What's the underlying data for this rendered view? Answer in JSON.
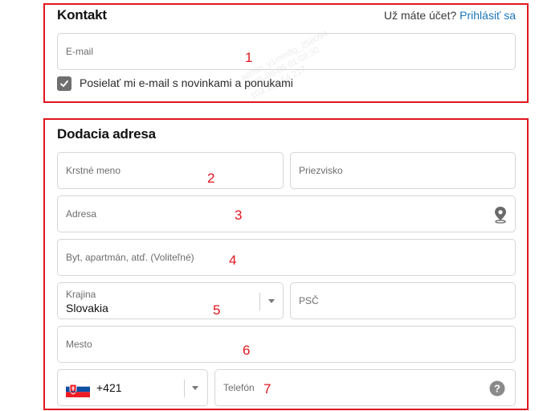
{
  "contact": {
    "title": "Kontakt",
    "login_prompt": "Už máte účet?",
    "login_link": "Prihlásiť sa",
    "email_placeholder": "E-mail",
    "newsletter_label": "Posielať mi e-mail s novinkami a ponukami",
    "newsletter_checked": true
  },
  "shipping": {
    "title": "Dodacia adresa",
    "first_name_placeholder": "Krstné meno",
    "last_name_placeholder": "Priezvisko",
    "address_placeholder": "Adresa",
    "apartment_placeholder": "Byt, apartmán, atď. (Voliteľné)",
    "country_label": "Krajina",
    "country_value": "Slovakia",
    "postal_placeholder": "PSČ",
    "city_placeholder": "Mesto",
    "phone_code": "+421",
    "phone_placeholder": "Telefón"
  },
  "annotations": [
    "1",
    "2",
    "3",
    "4",
    "5",
    "6",
    "7"
  ],
  "watermark": [
    "admin_y1mm8g_258094",
    "2025-09-05 01:08:30",
    "103.129.54.217"
  ],
  "colors": {
    "annotation_red": "#e0161e",
    "link_blue": "#1b75bb",
    "checkbox": "#6f6f6f"
  },
  "icons": [
    "checkmark-icon",
    "location-pin-icon",
    "chevron-down-icon",
    "slovakia-flag-icon",
    "help-icon"
  ]
}
